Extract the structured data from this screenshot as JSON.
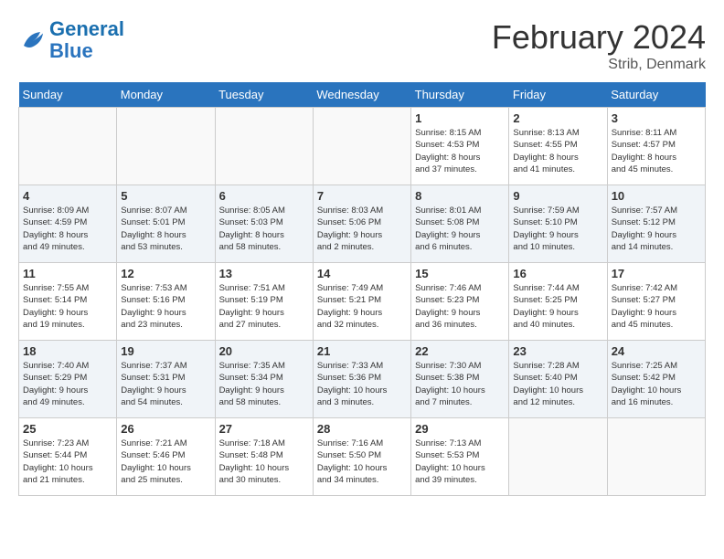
{
  "logo": {
    "text_general": "General",
    "text_blue": "Blue"
  },
  "title": "February 2024",
  "location": "Strib, Denmark",
  "days_of_week": [
    "Sunday",
    "Monday",
    "Tuesday",
    "Wednesday",
    "Thursday",
    "Friday",
    "Saturday"
  ],
  "weeks": [
    [
      {
        "day": "",
        "info": ""
      },
      {
        "day": "",
        "info": ""
      },
      {
        "day": "",
        "info": ""
      },
      {
        "day": "",
        "info": ""
      },
      {
        "day": "1",
        "info": "Sunrise: 8:15 AM\nSunset: 4:53 PM\nDaylight: 8 hours\nand 37 minutes."
      },
      {
        "day": "2",
        "info": "Sunrise: 8:13 AM\nSunset: 4:55 PM\nDaylight: 8 hours\nand 41 minutes."
      },
      {
        "day": "3",
        "info": "Sunrise: 8:11 AM\nSunset: 4:57 PM\nDaylight: 8 hours\nand 45 minutes."
      }
    ],
    [
      {
        "day": "4",
        "info": "Sunrise: 8:09 AM\nSunset: 4:59 PM\nDaylight: 8 hours\nand 49 minutes."
      },
      {
        "day": "5",
        "info": "Sunrise: 8:07 AM\nSunset: 5:01 PM\nDaylight: 8 hours\nand 53 minutes."
      },
      {
        "day": "6",
        "info": "Sunrise: 8:05 AM\nSunset: 5:03 PM\nDaylight: 8 hours\nand 58 minutes."
      },
      {
        "day": "7",
        "info": "Sunrise: 8:03 AM\nSunset: 5:06 PM\nDaylight: 9 hours\nand 2 minutes."
      },
      {
        "day": "8",
        "info": "Sunrise: 8:01 AM\nSunset: 5:08 PM\nDaylight: 9 hours\nand 6 minutes."
      },
      {
        "day": "9",
        "info": "Sunrise: 7:59 AM\nSunset: 5:10 PM\nDaylight: 9 hours\nand 10 minutes."
      },
      {
        "day": "10",
        "info": "Sunrise: 7:57 AM\nSunset: 5:12 PM\nDaylight: 9 hours\nand 14 minutes."
      }
    ],
    [
      {
        "day": "11",
        "info": "Sunrise: 7:55 AM\nSunset: 5:14 PM\nDaylight: 9 hours\nand 19 minutes."
      },
      {
        "day": "12",
        "info": "Sunrise: 7:53 AM\nSunset: 5:16 PM\nDaylight: 9 hours\nand 23 minutes."
      },
      {
        "day": "13",
        "info": "Sunrise: 7:51 AM\nSunset: 5:19 PM\nDaylight: 9 hours\nand 27 minutes."
      },
      {
        "day": "14",
        "info": "Sunrise: 7:49 AM\nSunset: 5:21 PM\nDaylight: 9 hours\nand 32 minutes."
      },
      {
        "day": "15",
        "info": "Sunrise: 7:46 AM\nSunset: 5:23 PM\nDaylight: 9 hours\nand 36 minutes."
      },
      {
        "day": "16",
        "info": "Sunrise: 7:44 AM\nSunset: 5:25 PM\nDaylight: 9 hours\nand 40 minutes."
      },
      {
        "day": "17",
        "info": "Sunrise: 7:42 AM\nSunset: 5:27 PM\nDaylight: 9 hours\nand 45 minutes."
      }
    ],
    [
      {
        "day": "18",
        "info": "Sunrise: 7:40 AM\nSunset: 5:29 PM\nDaylight: 9 hours\nand 49 minutes."
      },
      {
        "day": "19",
        "info": "Sunrise: 7:37 AM\nSunset: 5:31 PM\nDaylight: 9 hours\nand 54 minutes."
      },
      {
        "day": "20",
        "info": "Sunrise: 7:35 AM\nSunset: 5:34 PM\nDaylight: 9 hours\nand 58 minutes."
      },
      {
        "day": "21",
        "info": "Sunrise: 7:33 AM\nSunset: 5:36 PM\nDaylight: 10 hours\nand 3 minutes."
      },
      {
        "day": "22",
        "info": "Sunrise: 7:30 AM\nSunset: 5:38 PM\nDaylight: 10 hours\nand 7 minutes."
      },
      {
        "day": "23",
        "info": "Sunrise: 7:28 AM\nSunset: 5:40 PM\nDaylight: 10 hours\nand 12 minutes."
      },
      {
        "day": "24",
        "info": "Sunrise: 7:25 AM\nSunset: 5:42 PM\nDaylight: 10 hours\nand 16 minutes."
      }
    ],
    [
      {
        "day": "25",
        "info": "Sunrise: 7:23 AM\nSunset: 5:44 PM\nDaylight: 10 hours\nand 21 minutes."
      },
      {
        "day": "26",
        "info": "Sunrise: 7:21 AM\nSunset: 5:46 PM\nDaylight: 10 hours\nand 25 minutes."
      },
      {
        "day": "27",
        "info": "Sunrise: 7:18 AM\nSunset: 5:48 PM\nDaylight: 10 hours\nand 30 minutes."
      },
      {
        "day": "28",
        "info": "Sunrise: 7:16 AM\nSunset: 5:50 PM\nDaylight: 10 hours\nand 34 minutes."
      },
      {
        "day": "29",
        "info": "Sunrise: 7:13 AM\nSunset: 5:53 PM\nDaylight: 10 hours\nand 39 minutes."
      },
      {
        "day": "",
        "info": ""
      },
      {
        "day": "",
        "info": ""
      }
    ]
  ]
}
